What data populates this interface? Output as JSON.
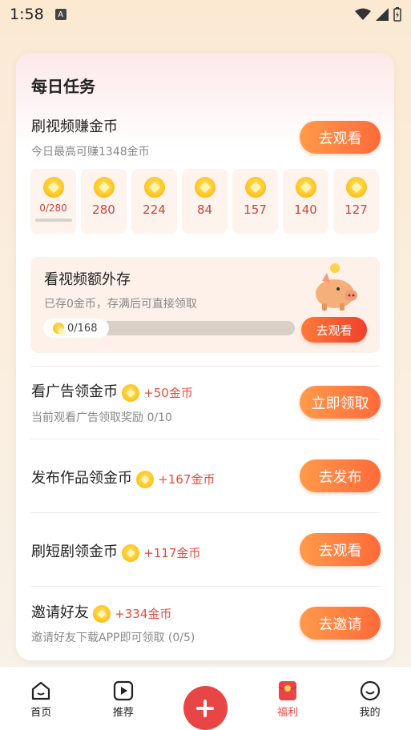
{
  "status": {
    "time": "1:58",
    "notif_icon": "A"
  },
  "card": {
    "title": "每日任务",
    "video_task": {
      "name": "刷视频赚金币",
      "sub": "今日最高可赚1348金币",
      "button": "去观看",
      "days": [
        "0/280",
        "280",
        "224",
        "84",
        "157",
        "140",
        "127"
      ]
    },
    "piggy": {
      "title": "看视频额外存",
      "sub": "已存0金币，存满后可直接领取",
      "progress_text": "0/168",
      "progress": 0,
      "button": "去观看"
    },
    "tasks": [
      {
        "name": "看广告领金币",
        "reward": "+50金币",
        "sub": "当前观看广告领取奖励 0/10",
        "button": "立即领取"
      },
      {
        "name": "发布作品领金币",
        "reward": "+167金币",
        "sub": "",
        "button": "去发布"
      },
      {
        "name": "刷短剧领金币",
        "reward": "+117金币",
        "sub": "",
        "button": "去观看"
      },
      {
        "name": "邀请好友",
        "reward": "+334金币",
        "sub": "邀请好友下载APP即可领取 (0/5)",
        "button": "去邀请"
      }
    ]
  },
  "nav": {
    "items": [
      {
        "label": "首页",
        "icon": "home-icon"
      },
      {
        "label": "推荐",
        "icon": "play-icon"
      },
      {
        "label": "",
        "icon": "plus-icon"
      },
      {
        "label": "福利",
        "icon": "red-envelope-icon"
      },
      {
        "label": "我的",
        "icon": "smile-icon"
      }
    ]
  },
  "colors": {
    "accent": "#ff6a3a",
    "reward": "#e94b3c",
    "plus": "#e84646"
  }
}
